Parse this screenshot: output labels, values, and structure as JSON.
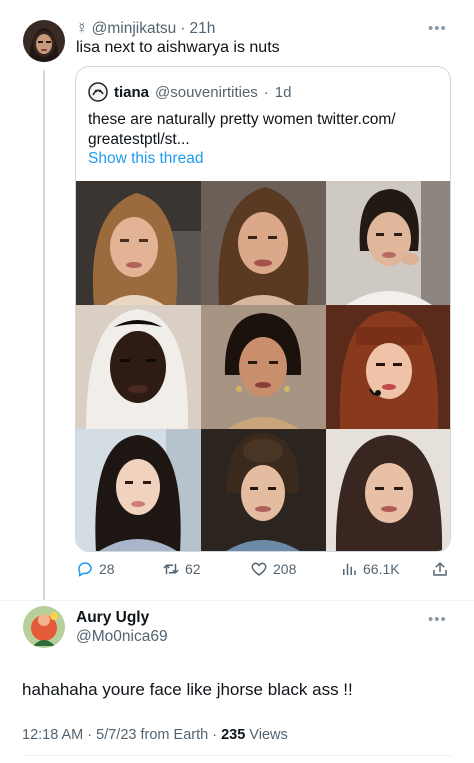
{
  "tweet": {
    "author_glyph": "☿",
    "handle": "@minjikatsu",
    "time": "21h",
    "text": "lisa next to aishwarya is nuts"
  },
  "quote": {
    "name": "tiana",
    "handle": "@souvenirtities",
    "time": "1d",
    "text": "these are naturally pretty women twitter.com/ greatestptl/st...",
    "link": "Show this thread",
    "photo_count": 9
  },
  "actions": {
    "replies": "28",
    "retweets": "62",
    "likes": "208",
    "views": "66.1K"
  },
  "reply": {
    "name": "Aury Ugly",
    "handle": "@Mo0nica69",
    "text": "hahahaha youre face like jhorse black ass !!",
    "timestamp": "12:18 AM · 5/7/23 from Earth · ",
    "views_count": "235",
    "views_label": " Views"
  },
  "colors": {
    "link": "#1d9bf0",
    "secondary": "#536471",
    "border": "#cfd9de"
  },
  "icons": [
    "more-icon",
    "reply-icon",
    "retweet-icon",
    "like-icon",
    "views-icon",
    "share-icon"
  ]
}
